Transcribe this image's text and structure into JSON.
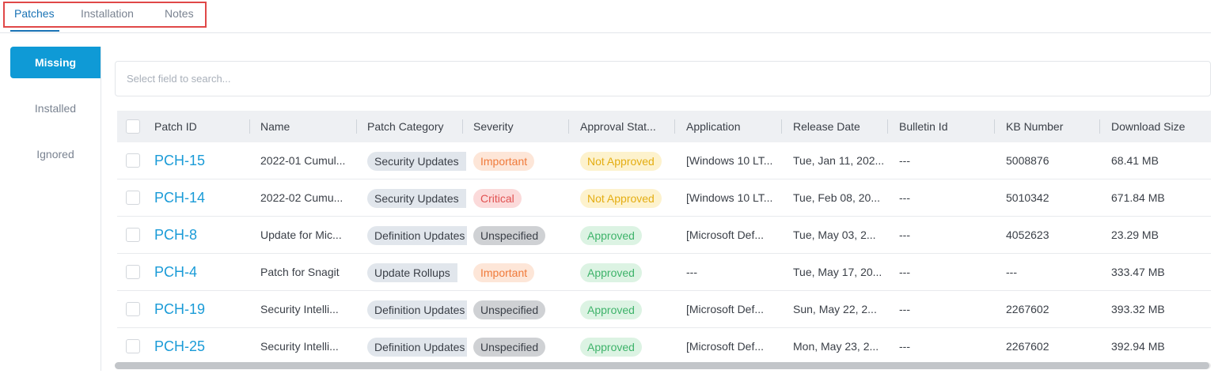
{
  "tabs": [
    {
      "label": "Patches",
      "active": true
    },
    {
      "label": "Installation",
      "active": false
    },
    {
      "label": "Notes",
      "active": false
    }
  ],
  "subnav": [
    {
      "label": "Missing",
      "active": true
    },
    {
      "label": "Installed",
      "active": false
    },
    {
      "label": "Ignored",
      "active": false
    }
  ],
  "search": {
    "placeholder": "Select field to search..."
  },
  "table": {
    "headers": [
      "Patch ID",
      "Name",
      "Patch Category",
      "Severity",
      "Approval Stat...",
      "Application",
      "Release Date",
      "Bulletin Id",
      "KB Number",
      "Download Size"
    ],
    "rows": [
      {
        "id": "PCH-15",
        "name": "2022-01 Cumul...",
        "category": "Security Updates",
        "severity": "Important",
        "approval": "Not Approved",
        "application": "[Windows 10 LT...",
        "release": "Tue, Jan 11, 202...",
        "bulletin": "---",
        "kb": "5008876",
        "size": "68.41 MB"
      },
      {
        "id": "PCH-14",
        "name": "2022-02 Cumu...",
        "category": "Security Updates",
        "severity": "Critical",
        "approval": "Not Approved",
        "application": "[Windows 10 LT...",
        "release": "Tue, Feb 08, 20...",
        "bulletin": "---",
        "kb": "5010342",
        "size": "671.84 MB"
      },
      {
        "id": "PCH-8",
        "name": "Update for Mic...",
        "category": "Definition Updates",
        "severity": "Unspecified",
        "approval": "Approved",
        "application": "[Microsoft Def...",
        "release": "Tue, May 03, 2...",
        "bulletin": "---",
        "kb": "4052623",
        "size": "23.29 MB"
      },
      {
        "id": "PCH-4",
        "name": "Patch for Snagit",
        "category": "Update Rollups",
        "severity": "Important",
        "approval": "Approved",
        "application": "---",
        "release": "Tue, May 17, 20...",
        "bulletin": "---",
        "kb": "---",
        "size": "333.47 MB"
      },
      {
        "id": "PCH-19",
        "name": "Security Intelli...",
        "category": "Definition Updates",
        "severity": "Unspecified",
        "approval": "Approved",
        "application": "[Microsoft Def...",
        "release": "Sun, May 22, 2...",
        "bulletin": "---",
        "kb": "2267602",
        "size": "393.32 MB"
      },
      {
        "id": "PCH-25",
        "name": "Security Intelli...",
        "category": "Definition Updates",
        "severity": "Unspecified",
        "approval": "Approved",
        "application": "[Microsoft Def...",
        "release": "Mon, May 23, 2...",
        "bulletin": "---",
        "kb": "2267602",
        "size": "392.94 MB"
      }
    ]
  },
  "colors": {
    "accent": "#1a9bd7",
    "active_subnav": "#0f9ad6",
    "highlight": "#e04848"
  }
}
